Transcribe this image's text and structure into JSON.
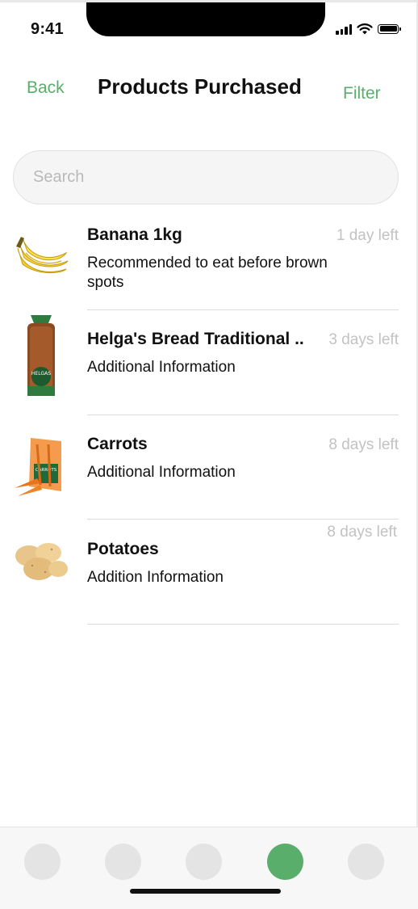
{
  "status_bar": {
    "time": "9:41"
  },
  "header": {
    "back_label": "Back",
    "title": "Products Purchased",
    "filter_label": "Filter"
  },
  "search": {
    "placeholder": "Search",
    "value": ""
  },
  "products": [
    {
      "name": "Banana 1kg",
      "info": "Recommended to eat before brown spots",
      "days_left": "1 day left",
      "image": "banana-image"
    },
    {
      "name": "Helga's Bread Traditional ..",
      "info": "Additional Information",
      "days_left": "3 days left",
      "image": "bread-image"
    },
    {
      "name": "Carrots",
      "info": "Additional Information",
      "days_left": "8 days left",
      "image": "carrots-image"
    },
    {
      "name": "Potatoes",
      "info": "Addition Information",
      "days_left": "8 days left",
      "image": "potatoes-image"
    }
  ],
  "bottom_nav": {
    "active_index": 3,
    "count": 5
  },
  "colors": {
    "accent": "#5aae6c",
    "muted_text": "#c2c2c2",
    "nav_inactive": "#e4e4e4"
  }
}
